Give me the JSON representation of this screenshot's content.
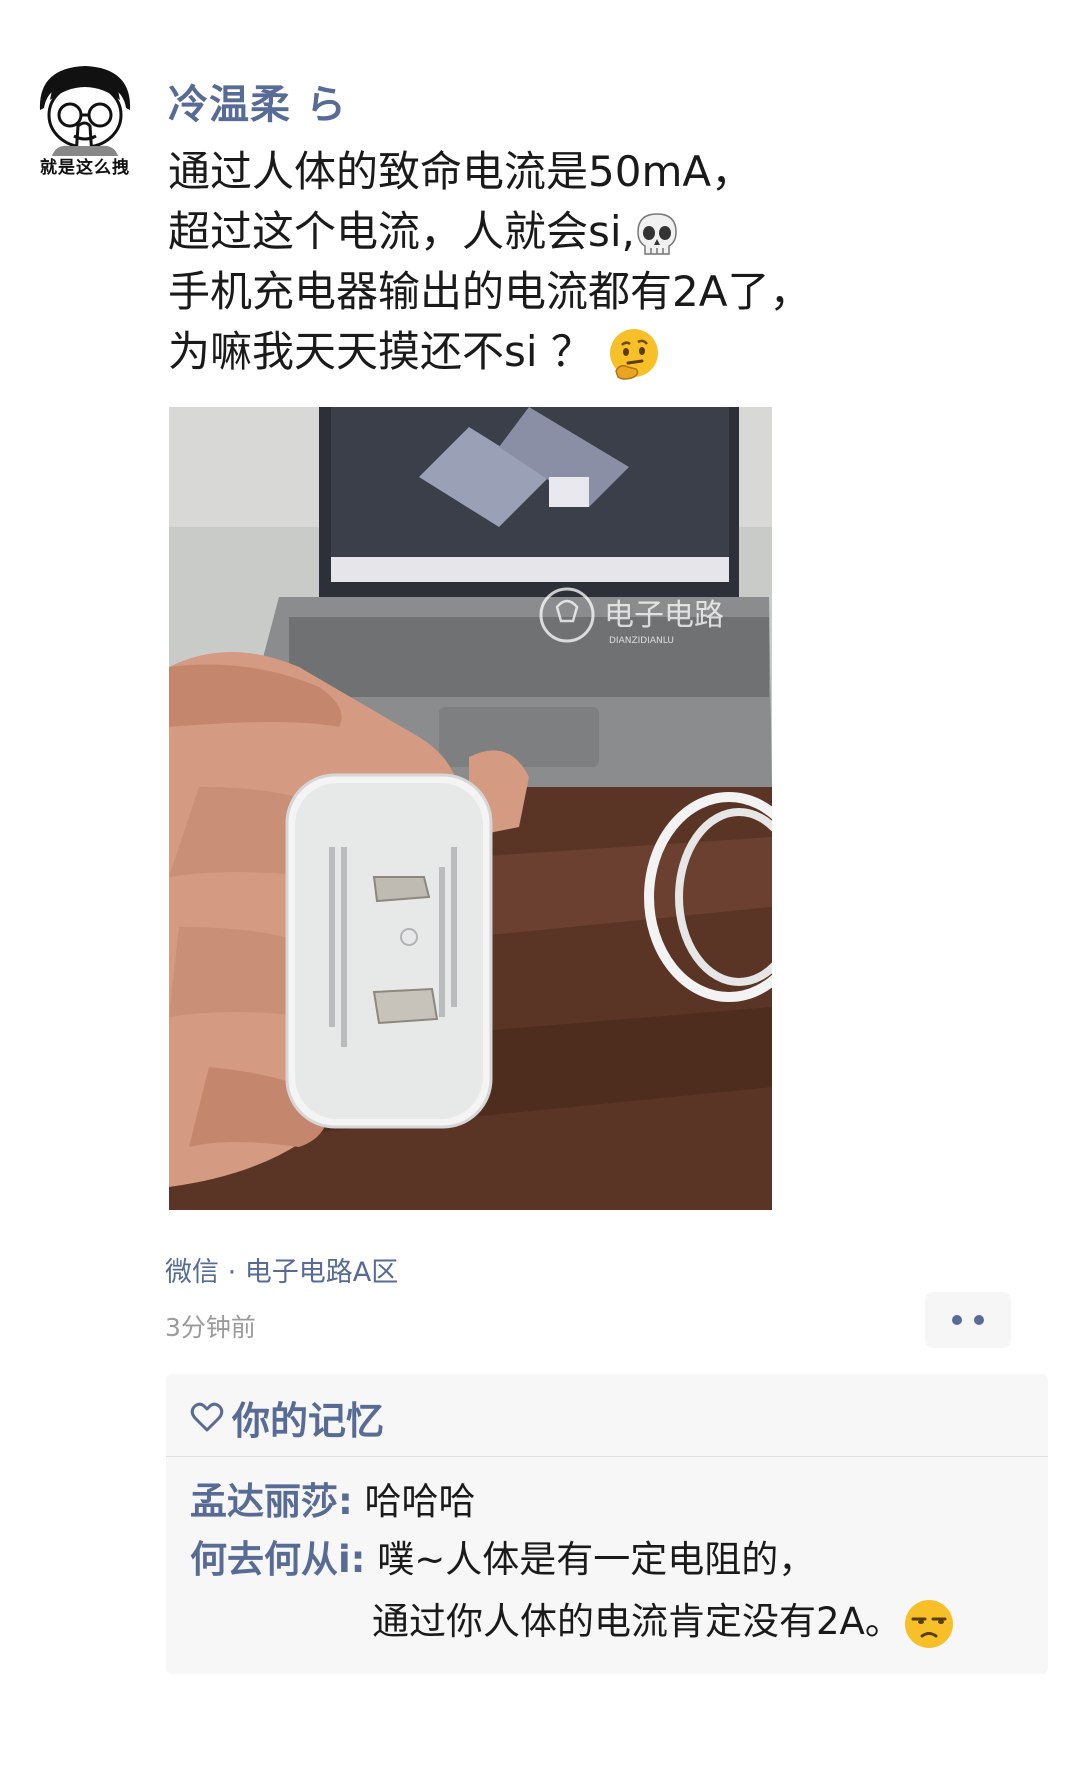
{
  "post": {
    "avatar_caption": "就是这么拽",
    "username": "冷温柔 ら",
    "lines": [
      "通过人体的致命电流是50mA，",
      "超过这个电流，人就会si,",
      "手机充电器输出的电流都有2A了，",
      "为嘛我天天摸还不si ？"
    ],
    "line2_emoji": "skull-emoji",
    "line4_emoji": "thinking-face-emoji",
    "photo": {
      "watermark_cn": "电子电路",
      "watermark_en": "DIANZIDIANLU"
    },
    "source": "微信 · 电子电路A区",
    "time": "3分钟前"
  },
  "interactions": {
    "likes": "你的记忆",
    "comments": [
      {
        "name": "孟达丽莎:",
        "text": " 哈哈哈"
      },
      {
        "name": "何去何从i:",
        "text": " 噗~人体是有一定电阻的，",
        "text_cont": "通过你人体的电流肯定没有2A。"
      }
    ],
    "comment_emoji": "unamused-face-emoji"
  },
  "colors": {
    "link_blue": "#576b95",
    "text": "#1a1a1a",
    "time_gray": "#9b9b9b",
    "panel_bg": "#f7f7f7"
  }
}
